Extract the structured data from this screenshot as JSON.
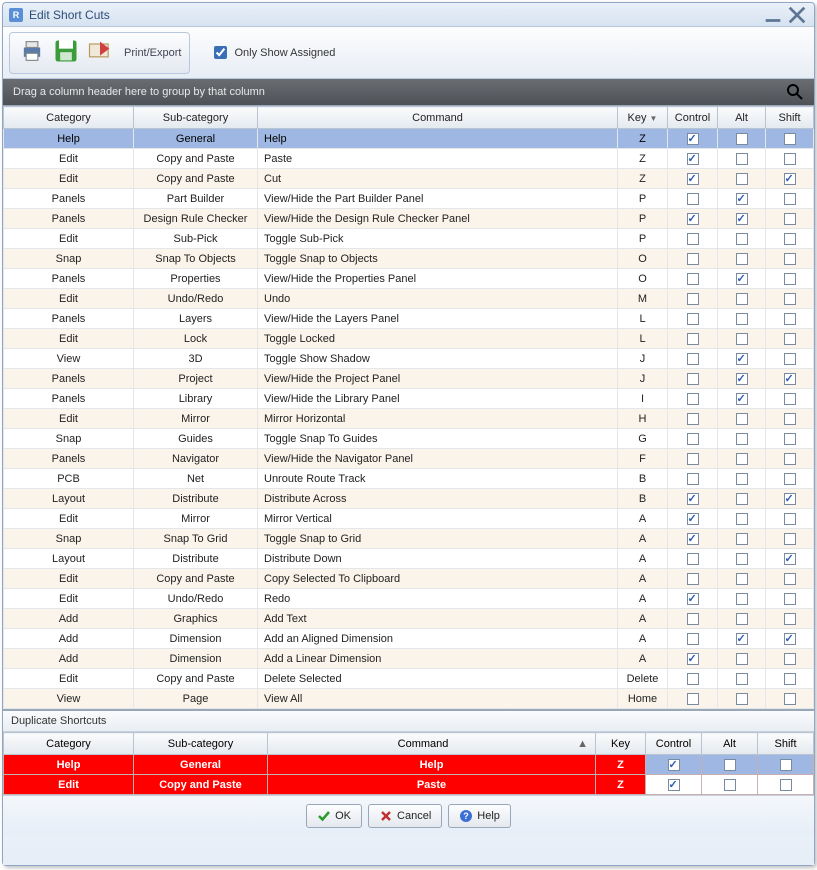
{
  "window": {
    "title": "Edit Short Cuts"
  },
  "toolbar": {
    "print_export": "Print/Export",
    "only_show_assigned": "Only Show Assigned",
    "only_show_assigned_checked": true
  },
  "groupbar": {
    "hint": "Drag a column header here to group by that column"
  },
  "columns": {
    "category": "Category",
    "sub_category": "Sub-category",
    "command": "Command",
    "key": "Key",
    "control": "Control",
    "alt": "Alt",
    "shift": "Shift",
    "sort_indicator": "▼"
  },
  "rows": [
    {
      "category": "Help",
      "sub": "General",
      "command": "Help",
      "key": "Z",
      "control": true,
      "alt": false,
      "shift": false,
      "selected": true
    },
    {
      "category": "Edit",
      "sub": "Copy and Paste",
      "command": "Paste",
      "key": "Z",
      "control": true,
      "alt": false,
      "shift": false
    },
    {
      "category": "Edit",
      "sub": "Copy and Paste",
      "command": "Cut",
      "key": "Z",
      "control": true,
      "alt": false,
      "shift": true
    },
    {
      "category": "Panels",
      "sub": "Part Builder",
      "command": "View/Hide the Part Builder Panel",
      "key": "P",
      "control": false,
      "alt": true,
      "shift": false
    },
    {
      "category": "Panels",
      "sub": "Design Rule Checker",
      "command": "View/Hide the Design Rule Checker Panel",
      "key": "P",
      "control": true,
      "alt": true,
      "shift": false
    },
    {
      "category": "Edit",
      "sub": "Sub-Pick",
      "command": "Toggle Sub-Pick",
      "key": "P",
      "control": false,
      "alt": false,
      "shift": false
    },
    {
      "category": "Snap",
      "sub": "Snap To Objects",
      "command": "Toggle Snap to Objects",
      "key": "O",
      "control": false,
      "alt": false,
      "shift": false
    },
    {
      "category": "Panels",
      "sub": "Properties",
      "command": "View/Hide the Properties Panel",
      "key": "O",
      "control": false,
      "alt": true,
      "shift": false
    },
    {
      "category": "Edit",
      "sub": "Undo/Redo",
      "command": "Undo",
      "key": "M",
      "control": false,
      "alt": false,
      "shift": false
    },
    {
      "category": "Panels",
      "sub": "Layers",
      "command": "View/Hide the Layers Panel",
      "key": "L",
      "control": false,
      "alt": false,
      "shift": false
    },
    {
      "category": "Edit",
      "sub": "Lock",
      "command": "Toggle Locked",
      "key": "L",
      "control": false,
      "alt": false,
      "shift": false
    },
    {
      "category": "View",
      "sub": "3D",
      "command": "Toggle Show Shadow",
      "key": "J",
      "control": false,
      "alt": true,
      "shift": false
    },
    {
      "category": "Panels",
      "sub": "Project",
      "command": "View/Hide the Project Panel",
      "key": "J",
      "control": false,
      "alt": true,
      "shift": true
    },
    {
      "category": "Panels",
      "sub": "Library",
      "command": "View/Hide the Library Panel",
      "key": "I",
      "control": false,
      "alt": true,
      "shift": false
    },
    {
      "category": "Edit",
      "sub": "Mirror",
      "command": "Mirror Horizontal",
      "key": "H",
      "control": false,
      "alt": false,
      "shift": false
    },
    {
      "category": "Snap",
      "sub": "Guides",
      "command": "Toggle Snap To Guides",
      "key": "G",
      "control": false,
      "alt": false,
      "shift": false
    },
    {
      "category": "Panels",
      "sub": "Navigator",
      "command": "View/Hide the Navigator Panel",
      "key": "F",
      "control": false,
      "alt": false,
      "shift": false
    },
    {
      "category": "PCB",
      "sub": "Net",
      "command": "Unroute Route Track",
      "key": "B",
      "control": false,
      "alt": false,
      "shift": false
    },
    {
      "category": "Layout",
      "sub": "Distribute",
      "command": "Distribute Across",
      "key": "B",
      "control": true,
      "alt": false,
      "shift": true
    },
    {
      "category": "Edit",
      "sub": "Mirror",
      "command": "Mirror Vertical",
      "key": "A",
      "control": true,
      "alt": false,
      "shift": false
    },
    {
      "category": "Snap",
      "sub": "Snap To Grid",
      "command": "Toggle Snap to Grid",
      "key": "A",
      "control": true,
      "alt": false,
      "shift": false
    },
    {
      "category": "Layout",
      "sub": "Distribute",
      "command": "Distribute Down",
      "key": "A",
      "control": false,
      "alt": false,
      "shift": true
    },
    {
      "category": "Edit",
      "sub": "Copy and Paste",
      "command": "Copy Selected To Clipboard",
      "key": "A",
      "control": false,
      "alt": false,
      "shift": false
    },
    {
      "category": "Edit",
      "sub": "Undo/Redo",
      "command": "Redo",
      "key": "A",
      "control": true,
      "alt": false,
      "shift": false
    },
    {
      "category": "Add",
      "sub": "Graphics",
      "command": "Add Text",
      "key": "A",
      "control": false,
      "alt": false,
      "shift": false
    },
    {
      "category": "Add",
      "sub": "Dimension",
      "command": "Add an Aligned Dimension",
      "key": "A",
      "control": false,
      "alt": true,
      "shift": true
    },
    {
      "category": "Add",
      "sub": "Dimension",
      "command": "Add a Linear Dimension",
      "key": "A",
      "control": true,
      "alt": false,
      "shift": false
    },
    {
      "category": "Edit",
      "sub": "Copy and Paste",
      "command": "Delete Selected",
      "key": "Delete",
      "control": false,
      "alt": false,
      "shift": false
    },
    {
      "category": "View",
      "sub": "Page",
      "command": "View All",
      "key": "Home",
      "control": false,
      "alt": false,
      "shift": false
    }
  ],
  "duplicates": {
    "title": "Duplicate Shortcuts",
    "rows": [
      {
        "category": "Help",
        "sub": "General",
        "command": "Help",
        "key": "Z",
        "control": true,
        "alt": false,
        "shift": false,
        "selected": true
      },
      {
        "category": "Edit",
        "sub": "Copy and Paste",
        "command": "Paste",
        "key": "Z",
        "control": true,
        "alt": false,
        "shift": false
      }
    ]
  },
  "buttons": {
    "ok": "OK",
    "cancel": "Cancel",
    "help": "Help"
  }
}
